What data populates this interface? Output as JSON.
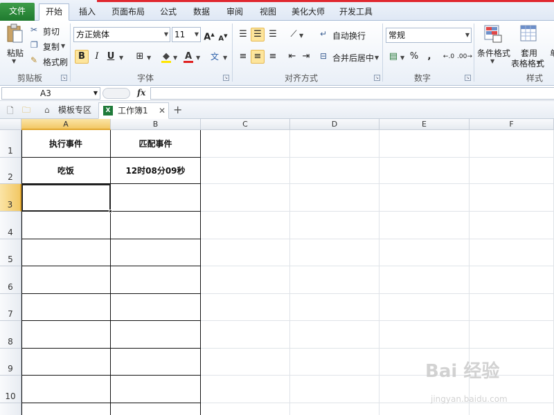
{
  "ribbon_tabs": [
    "文件",
    "开始",
    "插入",
    "页面布局",
    "公式",
    "数据",
    "审阅",
    "视图",
    "美化大师",
    "开发工具"
  ],
  "clipboard": {
    "paste": "粘贴",
    "cut": "剪切",
    "copy": "复制",
    "format_painter": "格式刷",
    "group": "剪贴板"
  },
  "font": {
    "name": "方正姚体",
    "size": "11",
    "group": "字体",
    "bold": "B",
    "italic": "I",
    "underline": "U",
    "grow": "A",
    "shrink": "A",
    "color_a": "A",
    "wen": "文"
  },
  "alignment": {
    "wrap": "自动换行",
    "merge": "合并后居中",
    "group": "对齐方式"
  },
  "number": {
    "format": "常规",
    "group": "数字",
    "percent": "%",
    "comma": ","
  },
  "styles": {
    "conditional": "条件格式",
    "table_line1": "套用",
    "table_line2": "表格格式",
    "group": "样式",
    "cut_off": "单"
  },
  "formula_bar": {
    "name_box": "A3",
    "fx": "fx",
    "value": ""
  },
  "doc_tabs": {
    "template": "模板专区",
    "workbook": "工作簿1",
    "add": "+"
  },
  "sheet": {
    "columns": [
      "A",
      "B",
      "C",
      "D",
      "E",
      "F"
    ],
    "rows": [
      "1",
      "2",
      "3",
      "4",
      "5",
      "6",
      "7",
      "8",
      "9",
      "10"
    ],
    "cells": {
      "A1": "执行事件",
      "B1": "匹配事件",
      "A2": "吃饭",
      "B2": "12时08分09秒"
    },
    "selected": "A3"
  },
  "watermark": {
    "main": "Bai 经验",
    "sub": "jingyan.baidu.com"
  },
  "colors": {
    "file_tab": "#2a8a3a",
    "accent_red": "#e0272f",
    "selection_header": "#f2c865"
  }
}
